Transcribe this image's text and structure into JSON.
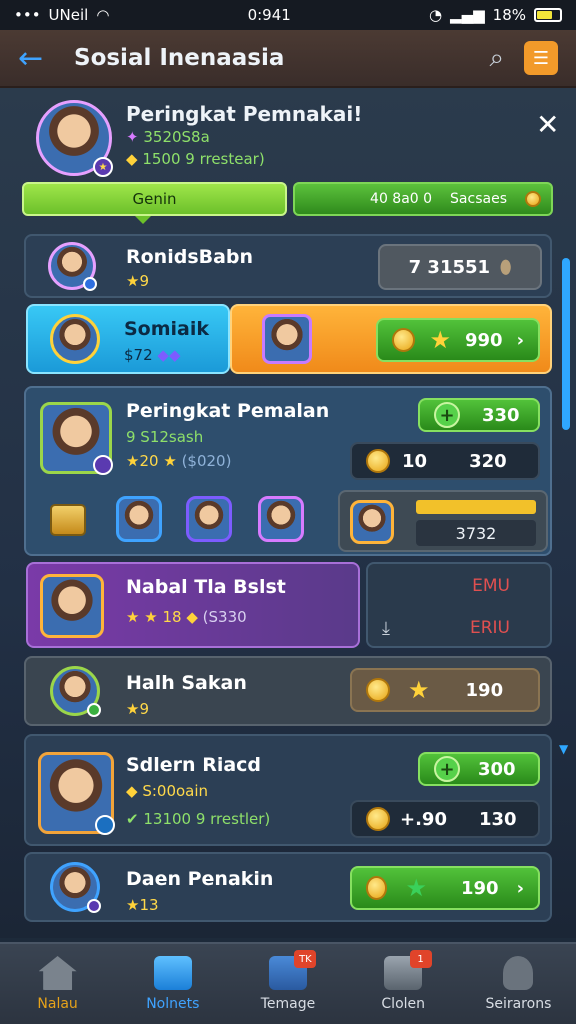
{
  "status": {
    "carrier": "UNeil",
    "time": "0:941",
    "battery": "18%"
  },
  "header": {
    "title": "Sosial Inenaasia"
  },
  "profile": {
    "title": "Peringkat Pemnakai!",
    "line1": "3520S8a",
    "line2": "1500 9 rrestear)"
  },
  "tabs": {
    "left": "Genin",
    "right_value": "40 8a0 0",
    "right_label": "Sacsaes"
  },
  "rows": [
    {
      "name": "RonidsBabn",
      "sub": "9",
      "value": "7 31551"
    },
    {
      "name": "Somiaik",
      "sub": "$72",
      "value": "990"
    },
    {
      "name": "Peringkat Pemalan",
      "sub1": "9 S12sash",
      "sub2": "20",
      "sub2b": "($020)",
      "pill1": "330",
      "pill2a": "10",
      "pill2b": "320",
      "banner_label": "3732"
    },
    {
      "name": "Nabal Tla Bslst",
      "sub": "18",
      "sub2": "(S330",
      "side1": "EMU",
      "side2": "ERIU"
    },
    {
      "name": "Halh Sakan",
      "sub": "9",
      "value": "190"
    },
    {
      "name": "Sdlern Riacd",
      "sub1": "S:00oain",
      "sub2": "13100 9 rrestler)",
      "pill1": "300",
      "pill2a": "+.90",
      "pill2b": "130"
    },
    {
      "name": "Daen Penakin",
      "sub": "13",
      "value": "190"
    }
  ],
  "nav": [
    {
      "label": "Nalau",
      "color": "#e6a21a"
    },
    {
      "label": "Nolnets",
      "color": "#3fa3ff"
    },
    {
      "label": "Temage",
      "badge": "TK"
    },
    {
      "label": "Clolen",
      "badge": "1"
    },
    {
      "label": "Seirarons"
    }
  ]
}
